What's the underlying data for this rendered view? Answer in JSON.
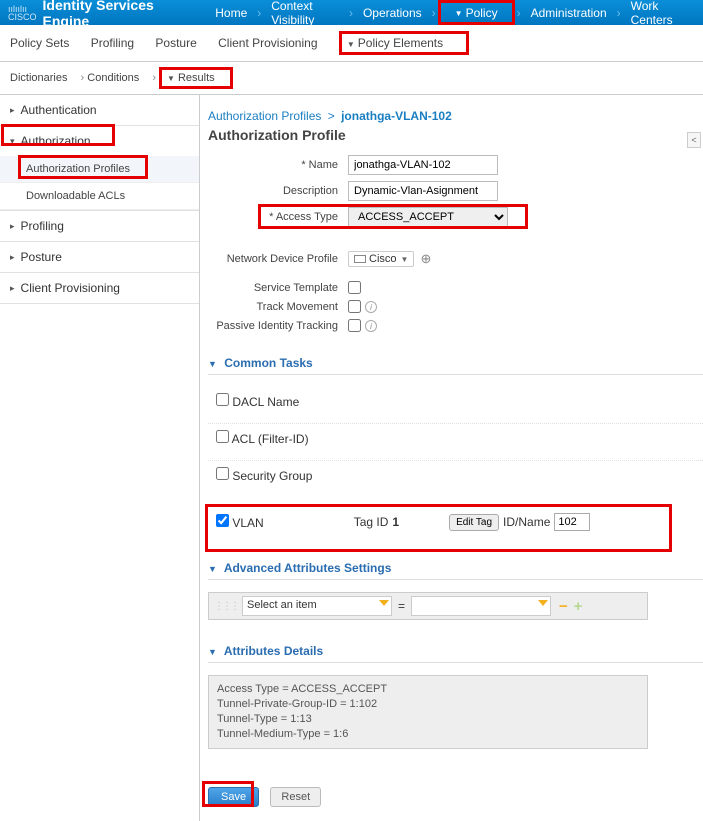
{
  "banner": {
    "logo_top": "ıılıılıı",
    "logo_bottom": "CISCO",
    "title": "Identity Services Engine",
    "items": [
      "Home",
      "Context Visibility",
      "Operations",
      "Policy",
      "Administration",
      "Work Centers"
    ]
  },
  "subnav": {
    "items": [
      "Policy Sets",
      "Profiling",
      "Posture",
      "Client Provisioning",
      "Policy Elements"
    ]
  },
  "ternav": {
    "items": [
      "Dictionaries",
      "Conditions",
      "Results"
    ]
  },
  "sidebar": {
    "authentication": "Authentication",
    "authorization": "Authorization",
    "authz_children": {
      "profiles": "Authorization Profiles",
      "dacls": "Downloadable ACLs"
    },
    "profiling": "Profiling",
    "posture": "Posture",
    "client_prov": "Client Provisioning"
  },
  "breadcrumb": {
    "parent": "Authorization Profiles",
    "current": "jonathga-VLAN-102"
  },
  "page_title": "Authorization Profile",
  "form": {
    "name_label": "* Name",
    "name_value": "jonathga-VLAN-102",
    "desc_label": "Description",
    "desc_value": "Dynamic-Vlan-Asignment",
    "access_label": "* Access Type",
    "access_value": "ACCESS_ACCEPT",
    "ndp_label": "Network Device Profile",
    "ndp_value": "Cisco",
    "svc_tpl_label": "Service Template",
    "track_label": "Track Movement",
    "pit_label": "Passive Identity Tracking"
  },
  "sections": {
    "common_tasks": "Common Tasks",
    "advanced": "Advanced Attributes Settings",
    "details": "Attributes Details"
  },
  "tasks": {
    "dacl": "DACL Name",
    "acl": "ACL (Filter-ID)",
    "secgroup": "Security Group",
    "vlan": "VLAN",
    "tagid_label": "Tag ID",
    "tagid_value": "1",
    "edit_tag": "Edit Tag",
    "idname_label": "ID/Name",
    "idname_value": "102"
  },
  "advanced": {
    "placeholder": "Select an item"
  },
  "details": {
    "line1": "Access Type = ACCESS_ACCEPT",
    "line2": "Tunnel-Private-Group-ID = 1:102",
    "line3": "Tunnel-Type = 1:13",
    "line4": "Tunnel-Medium-Type = 1:6"
  },
  "buttons": {
    "save": "Save",
    "reset": "Reset"
  }
}
